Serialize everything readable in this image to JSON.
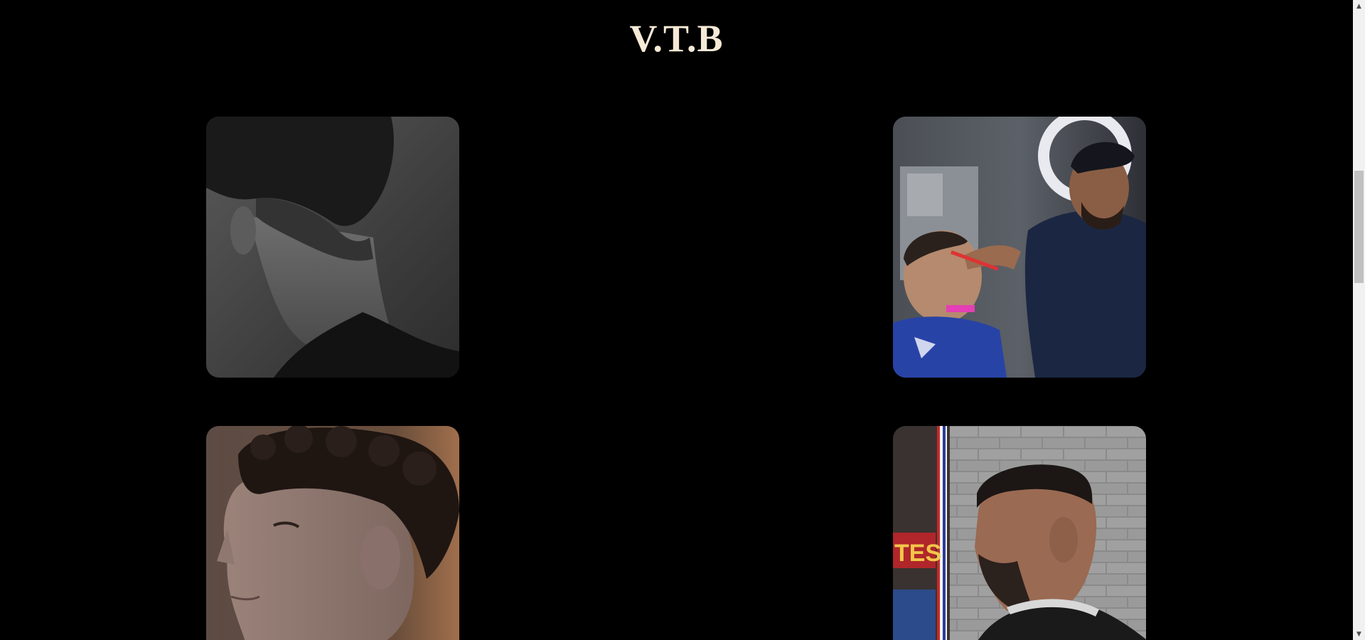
{
  "header": {
    "brand": "V.T.B"
  },
  "gallery": {
    "items": [
      {
        "icon": "haircut-photo-taper-back-view"
      },
      {
        "icon": "haircut-photo-barber-at-work"
      },
      {
        "icon": "haircut-photo-curly-fade"
      },
      {
        "icon": "haircut-photo-combover-fade"
      }
    ]
  },
  "scrollbar": {
    "up_arrow": "▲",
    "down_arrow": "▼"
  },
  "colors": {
    "background": "#000000",
    "brand_text": "#f6ead6"
  }
}
